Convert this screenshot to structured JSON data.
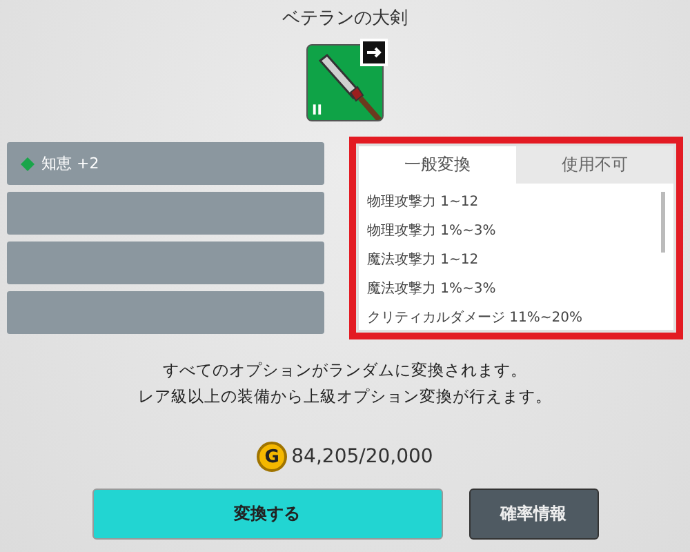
{
  "item": {
    "name": "ベテランの大剣",
    "grade": "II"
  },
  "slots": [
    {
      "kind": "stat",
      "text": "知恵 +2"
    },
    {
      "kind": "empty"
    },
    {
      "kind": "empty"
    },
    {
      "kind": "empty"
    }
  ],
  "tabs": [
    {
      "label": "一般変換",
      "selected": true
    },
    {
      "label": "使用不可",
      "selected": false
    }
  ],
  "options": [
    "物理攻撃力 1~12",
    "物理攻撃力 1%~3%",
    "魔法攻撃力 1~12",
    "魔法攻撃力 1%~3%",
    "クリティカルダメージ 11%~20%"
  ],
  "notice": [
    "すべてのオプションがランダムに変換されます。",
    "レア級以上の装備から上級オプション変換が行えます。"
  ],
  "cost": {
    "coin": "G",
    "amount": "84,205/20,000"
  },
  "buttons": [
    {
      "kind": "primary",
      "label": "変換する"
    },
    {
      "kind": "secondary",
      "label": "確率情報"
    }
  ]
}
